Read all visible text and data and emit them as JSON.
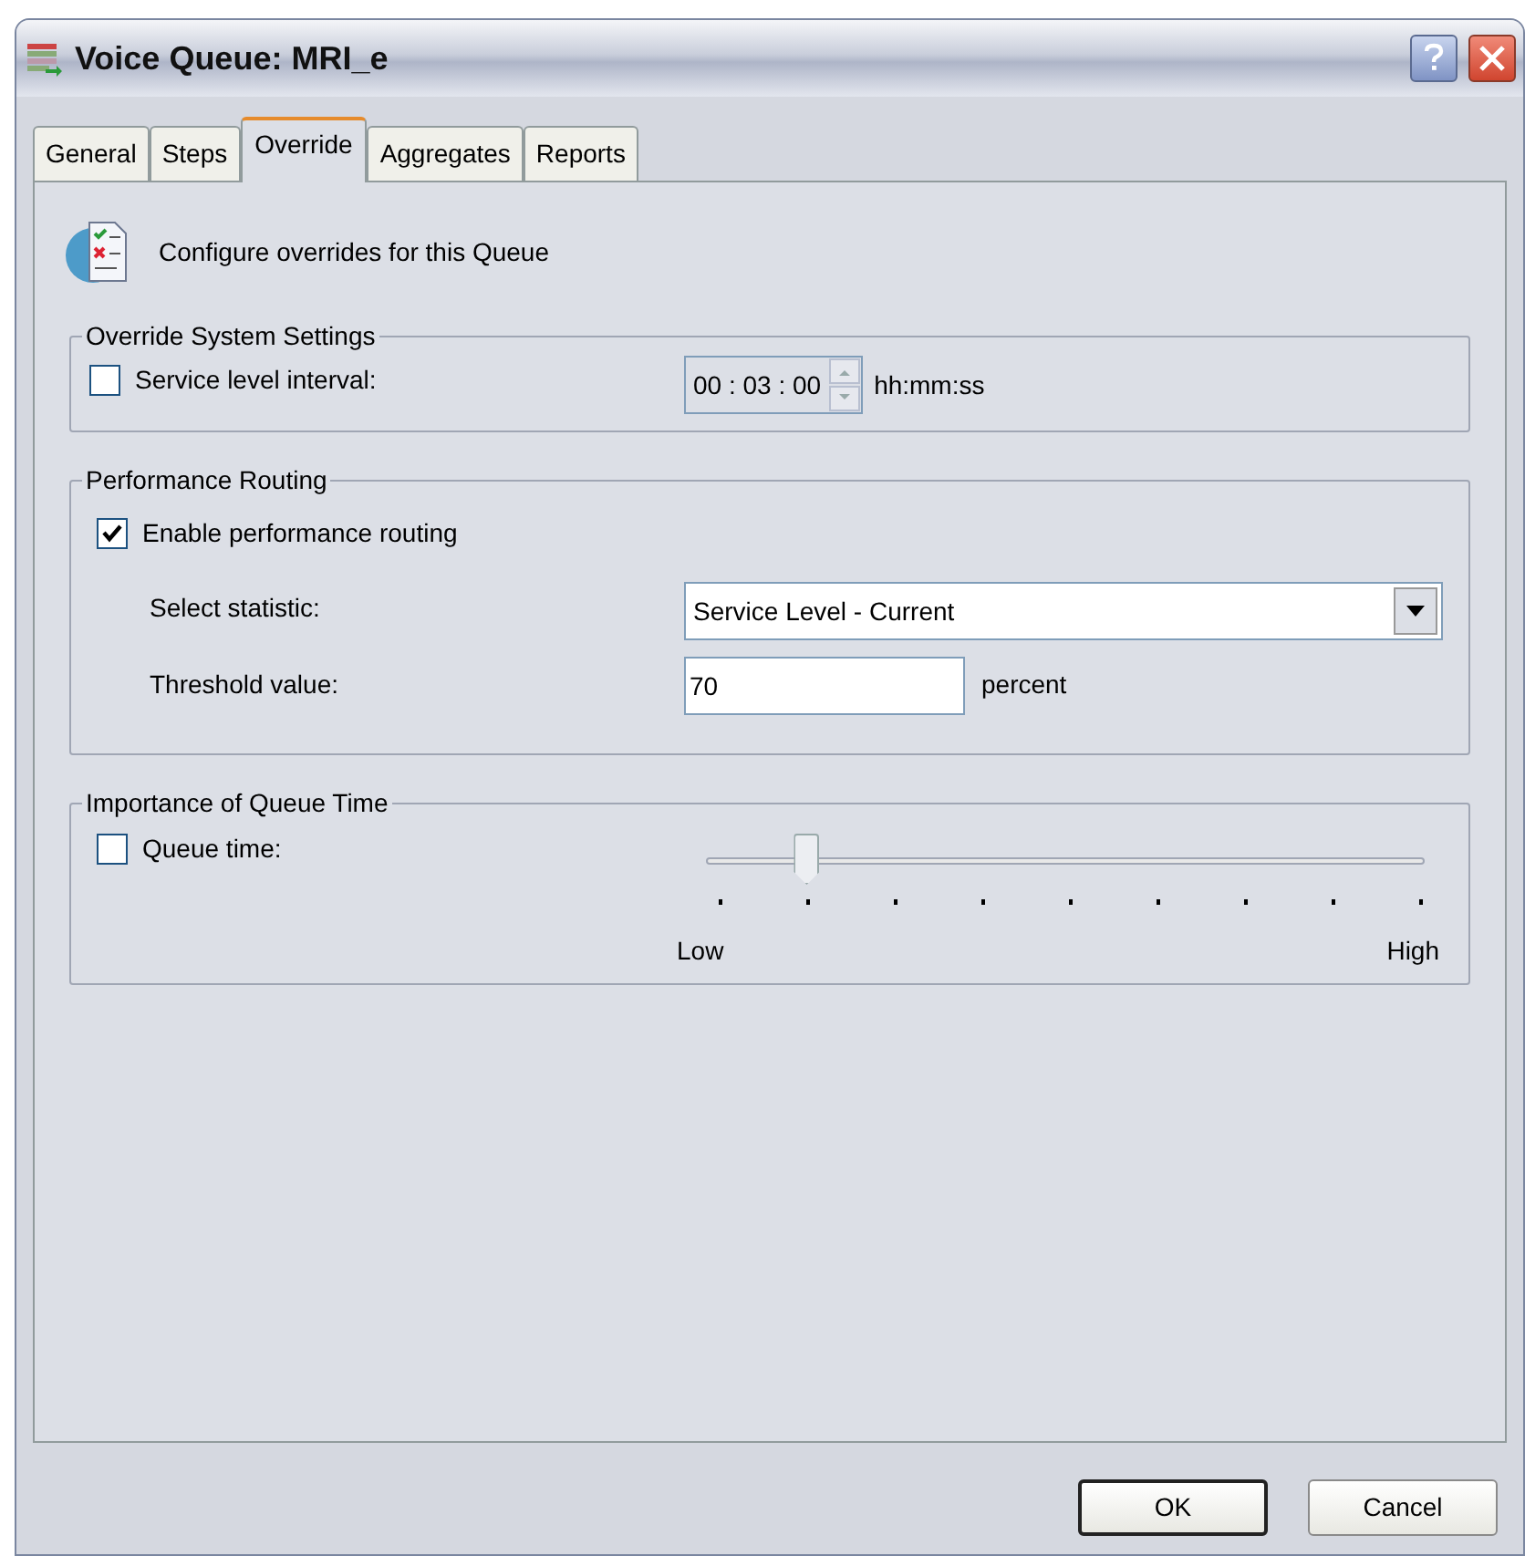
{
  "window": {
    "title": "Voice Queue: MRI_e"
  },
  "tabs": [
    {
      "label": "General",
      "selected": false
    },
    {
      "label": "Steps",
      "selected": false
    },
    {
      "label": "Override",
      "selected": true
    },
    {
      "label": "Aggregates",
      "selected": false
    },
    {
      "label": "Reports",
      "selected": false
    }
  ],
  "header": {
    "text": "Configure overrides for this Queue"
  },
  "override_system_settings": {
    "title": "Override System Settings",
    "service_level": {
      "label": "Service level interval:",
      "checked": false,
      "value": "00 : 03 : 00",
      "unit": "hh:mm:ss"
    }
  },
  "performance_routing": {
    "title": "Performance Routing",
    "enable": {
      "label": "Enable performance routing",
      "checked": true
    },
    "statistic": {
      "label": "Select statistic:",
      "value": "Service Level - Current"
    },
    "threshold": {
      "label": "Threshold value:",
      "value": "70",
      "unit": "percent"
    }
  },
  "importance_of_queue_time": {
    "title": "Importance of Queue Time",
    "queue_time": {
      "label": "Queue time:",
      "checked": false
    },
    "slider": {
      "level": 0.125,
      "low_label": "Low",
      "high_label": "High"
    }
  },
  "buttons": [
    {
      "label": "OK",
      "default": true
    },
    {
      "label": "Cancel",
      "default": false
    }
  ]
}
